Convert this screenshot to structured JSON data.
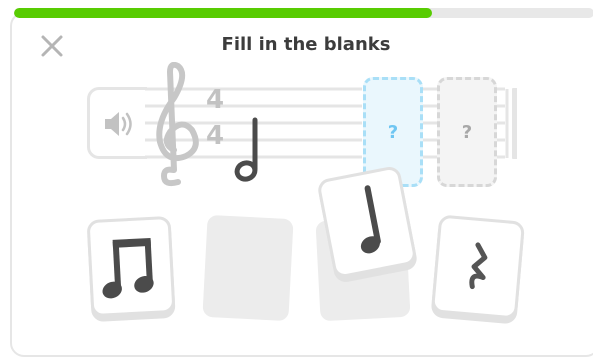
{
  "title": "Fill in the blanks",
  "progress": {
    "fraction": 0.72,
    "color": "#58cc02"
  },
  "staff": {
    "time_signature_top": "4",
    "time_signature_bottom": "4"
  },
  "blanks": [
    {
      "label": "?",
      "state": "selected"
    },
    {
      "label": "?",
      "state": "empty"
    }
  ],
  "choices": [
    {
      "name": "eighth-notes",
      "icon": "beamed-eighth-notes-icon"
    },
    {
      "name": "empty-slot-1",
      "icon": ""
    },
    {
      "name": "empty-slot-2",
      "icon": ""
    },
    {
      "name": "quarter-note",
      "icon": "quarter-note-icon",
      "state": "lifted"
    },
    {
      "name": "quarter-rest",
      "icon": "quarter-rest-icon"
    }
  ],
  "icons": {
    "close": "close-icon",
    "speaker": "speaker-icon",
    "clef": "treble-clef-icon",
    "half_note": "half-note-icon"
  }
}
